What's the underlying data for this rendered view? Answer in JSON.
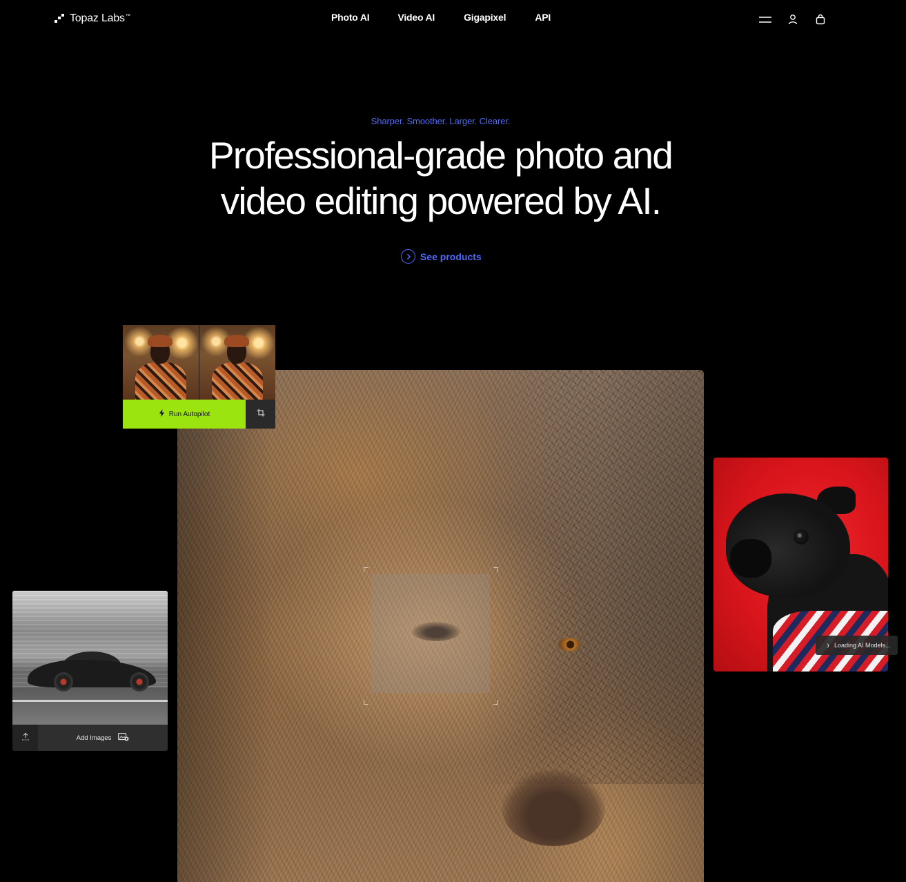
{
  "brand": {
    "name": "Topaz Labs",
    "trademark": "™"
  },
  "nav": {
    "links": [
      "Photo AI",
      "Video AI",
      "Gigapixel",
      "API"
    ],
    "icons": [
      "menu-icon",
      "user-icon",
      "cart-icon"
    ]
  },
  "hero": {
    "eyebrow": "Sharper. Smoother. Larger. Clearer.",
    "headline_line1": "Professional-grade photo and",
    "headline_line2": "video editing powered by AI.",
    "cta_label": "See products"
  },
  "autopilot_card": {
    "button_label": "Run Autopilot",
    "icons": [
      "lightning-icon",
      "crop-icon"
    ]
  },
  "car_card": {
    "button_label": "Add Images",
    "icons": [
      "upload-icon",
      "add-image-icon"
    ]
  },
  "pug_card": {
    "status_text": "Loading AI Models..."
  },
  "colors": {
    "background": "#000000",
    "accent_blue": "#4f6bff",
    "autopilot_green": "#9be40f",
    "pug_red": "#e01d23"
  }
}
